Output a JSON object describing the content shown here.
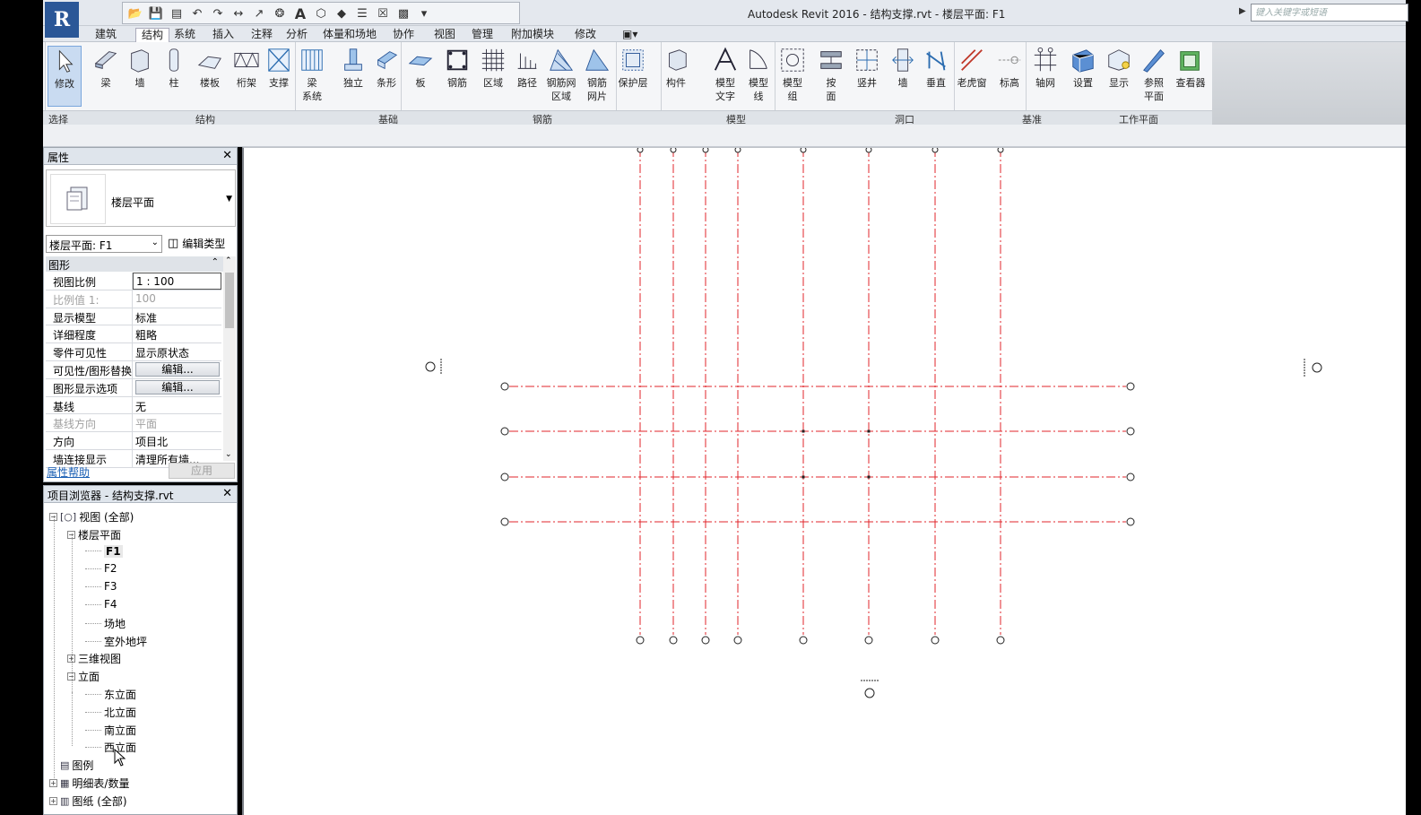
{
  "titlebar": {
    "title": "Autodesk Revit 2016 -     结构支撑.rvt - 楼层平面: F1",
    "search_placeholder": "键入关键字或短语",
    "app_letter": "R"
  },
  "tabs": [
    "建筑",
    "结构",
    "系统",
    "插入",
    "注释",
    "分析",
    "体量和场地",
    "协作",
    "视图",
    "管理",
    "附加模块",
    "修改"
  ],
  "active_tab": "结构",
  "ribbon": {
    "buttons": [
      {
        "label": "修改",
        "label2": "",
        "icon": "cursor-icon"
      },
      {
        "label": "梁",
        "label2": "",
        "icon": "beam-icon"
      },
      {
        "label": "墙",
        "label2": "",
        "icon": "wall-icon"
      },
      {
        "label": "柱",
        "label2": "",
        "icon": "column-icon"
      },
      {
        "label": "楼板",
        "label2": "",
        "icon": "floor-icon"
      },
      {
        "label": "桁架",
        "label2": "",
        "icon": "truss-icon"
      },
      {
        "label": "支撑",
        "label2": "",
        "icon": "brace-icon"
      },
      {
        "label": "梁",
        "label2": "系统",
        "icon": "beam-system-icon"
      },
      {
        "label": "独立",
        "label2": "",
        "icon": "isolated-foundation-icon"
      },
      {
        "label": "条形",
        "label2": "",
        "icon": "strip-foundation-icon"
      },
      {
        "label": "板",
        "label2": "",
        "icon": "slab-foundation-icon"
      },
      {
        "label": "钢筋",
        "label2": "",
        "icon": "rebar-icon"
      },
      {
        "label": "区域",
        "label2": "",
        "icon": "area-rebar-icon"
      },
      {
        "label": "路径",
        "label2": "",
        "icon": "path-rebar-icon"
      },
      {
        "label": "钢筋网",
        "label2": "区域",
        "icon": "fabric-area-icon"
      },
      {
        "label": "钢筋",
        "label2": "网片",
        "icon": "fabric-sheet-icon"
      },
      {
        "label": "保护层",
        "label2": "",
        "icon": "cover-icon"
      },
      {
        "label": "构件",
        "label2": "",
        "icon": "component-icon"
      },
      {
        "label": "模型",
        "label2": "文字",
        "icon": "model-text-icon"
      },
      {
        "label": "模型",
        "label2": "线",
        "icon": "model-line-icon"
      },
      {
        "label": "模型",
        "label2": "组",
        "icon": "model-group-icon"
      },
      {
        "label": "按",
        "label2": "面",
        "icon": "by-face-icon"
      },
      {
        "label": "竖井",
        "label2": "",
        "icon": "shaft-icon"
      },
      {
        "label": "墙",
        "label2": "",
        "icon": "wall-opening-icon"
      },
      {
        "label": "垂直",
        "label2": "",
        "icon": "vertical-opening-icon"
      },
      {
        "label": "老虎窗",
        "label2": "",
        "icon": "dormer-icon"
      },
      {
        "label": "标高",
        "label2": "",
        "icon": "level-icon"
      },
      {
        "label": "轴网",
        "label2": "",
        "icon": "grid-icon"
      },
      {
        "label": "设置",
        "label2": "",
        "icon": "set-workplane-icon"
      },
      {
        "label": "显示",
        "label2": "",
        "icon": "show-workplane-icon"
      },
      {
        "label": "参照",
        "label2": "平面",
        "icon": "ref-plane-icon"
      },
      {
        "label": "查看器",
        "label2": "",
        "icon": "viewer-icon"
      }
    ],
    "panels": [
      "选择",
      "结构",
      "基础",
      "钢筋",
      "模型",
      "洞口",
      "基准",
      "工作平面"
    ]
  },
  "properties": {
    "title": "属性",
    "type_name": "楼层平面",
    "instance_selector": "楼层平面: F1",
    "edit_type": "编辑类型",
    "group": "图形",
    "rows": [
      {
        "k": "视图比例",
        "v": "1 : 100",
        "style": "boxed"
      },
      {
        "k": "比例值 1:",
        "v": "100",
        "style": "dim"
      },
      {
        "k": "显示模型",
        "v": "标准",
        "style": ""
      },
      {
        "k": "详细程度",
        "v": "粗略",
        "style": ""
      },
      {
        "k": "零件可见性",
        "v": "显示原状态",
        "style": ""
      },
      {
        "k": "可见性/图形替换",
        "v": "编辑...",
        "style": "btn"
      },
      {
        "k": "图形显示选项",
        "v": "编辑...",
        "style": "btn"
      },
      {
        "k": "基线",
        "v": "无",
        "style": ""
      },
      {
        "k": "基线方向",
        "v": "平面",
        "style": "dim"
      },
      {
        "k": "方向",
        "v": "项目北",
        "style": ""
      },
      {
        "k": "墙连接显示",
        "v": "清理所有墙...",
        "style": ""
      }
    ],
    "help": "属性帮助",
    "apply": "应用"
  },
  "browser": {
    "title": "项目浏览器 - 结构支撑.rvt",
    "tree": [
      {
        "label": "视图 (全部)",
        "level": 0,
        "pm": "−",
        "icon": "views-icon"
      },
      {
        "label": "楼层平面",
        "level": 1,
        "pm": "−",
        "icon": ""
      },
      {
        "label": "F1",
        "level": 2,
        "pm": "",
        "icon": "",
        "bold": true
      },
      {
        "label": "F2",
        "level": 2,
        "pm": "",
        "icon": ""
      },
      {
        "label": "F3",
        "level": 2,
        "pm": "",
        "icon": ""
      },
      {
        "label": "F4",
        "level": 2,
        "pm": "",
        "icon": ""
      },
      {
        "label": "场地",
        "level": 2,
        "pm": "",
        "icon": ""
      },
      {
        "label": "室外地坪",
        "level": 2,
        "pm": "",
        "icon": ""
      },
      {
        "label": "三维视图",
        "level": 1,
        "pm": "+",
        "icon": ""
      },
      {
        "label": "立面",
        "level": 1,
        "pm": "−",
        "icon": ""
      },
      {
        "label": "东立面",
        "level": 2,
        "pm": "",
        "icon": ""
      },
      {
        "label": "北立面",
        "level": 2,
        "pm": "",
        "icon": ""
      },
      {
        "label": "南立面",
        "level": 2,
        "pm": "",
        "icon": ""
      },
      {
        "label": "西立面",
        "level": 2,
        "pm": "",
        "icon": ""
      },
      {
        "label": "图例",
        "level": 0,
        "pm": "",
        "icon": "legend-icon"
      },
      {
        "label": "明细表/数量",
        "level": 0,
        "pm": "+",
        "icon": "schedule-icon"
      },
      {
        "label": "图纸 (全部)",
        "level": 0,
        "pm": "+",
        "icon": "sheet-icon"
      }
    ]
  },
  "colors": {
    "grid_line": "#e0262b",
    "accent": "#2b5797"
  }
}
